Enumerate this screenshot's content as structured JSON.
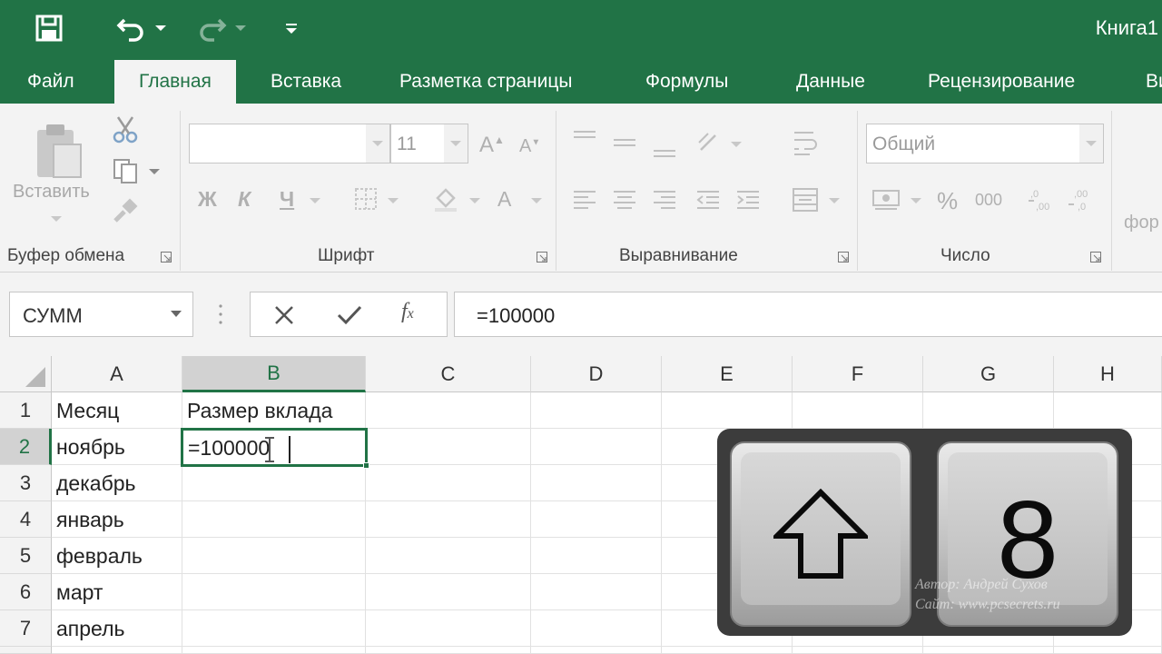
{
  "app": {
    "title": "Книга1",
    "accent_color": "#217346",
    "quick_access": [
      {
        "icon": "save-icon"
      },
      {
        "icon": "undo-icon"
      },
      {
        "icon": "redo-icon"
      },
      {
        "icon": "customize-qat-icon"
      }
    ]
  },
  "ribbon": {
    "tabs": [
      {
        "label": "Файл"
      },
      {
        "label": "Главная",
        "active": true
      },
      {
        "label": "Вставка"
      },
      {
        "label": "Разметка страницы"
      },
      {
        "label": "Формулы"
      },
      {
        "label": "Данные"
      },
      {
        "label": "Рецензирование"
      },
      {
        "label": "Ви"
      }
    ],
    "clipboard": {
      "label": "Буфер обмена",
      "paste_label": "Вставить"
    },
    "font": {
      "label": "Шрифт",
      "font_name": "",
      "font_size": "11",
      "bold": "Ж",
      "italic": "К",
      "underline": "Ч"
    },
    "alignment": {
      "label": "Выравнивание"
    },
    "number": {
      "label": "Число",
      "format": "Общий",
      "percent": "%",
      "thousands": "000"
    },
    "styles": {
      "partial_label": "фор"
    }
  },
  "formula_bar": {
    "name_box": "СУММ",
    "formula": "=100000"
  },
  "sheet": {
    "columns": [
      "A",
      "B",
      "C",
      "D",
      "E",
      "F",
      "G",
      "H"
    ],
    "selected_column": "B",
    "rows": [
      {
        "num": "1",
        "A": "Месяц",
        "B": "Размер вклада"
      },
      {
        "num": "2",
        "A": "ноябрь",
        "B": "=100000"
      },
      {
        "num": "3",
        "A": "декабрь",
        "B": ""
      },
      {
        "num": "4",
        "A": "январь",
        "B": ""
      },
      {
        "num": "5",
        "A": "февраль",
        "B": ""
      },
      {
        "num": "6",
        "A": "март",
        "B": ""
      },
      {
        "num": "7",
        "A": "апрель",
        "B": ""
      }
    ],
    "active_cell": "B2",
    "active_cell_value": "=100000"
  },
  "overlay": {
    "keys": [
      {
        "icon": "shift-arrow-icon"
      },
      {
        "label": "8"
      }
    ],
    "watermark": {
      "author": "Автор: Андрей Сухов",
      "site": "Сайт: www.pcsecrets.ru"
    }
  }
}
